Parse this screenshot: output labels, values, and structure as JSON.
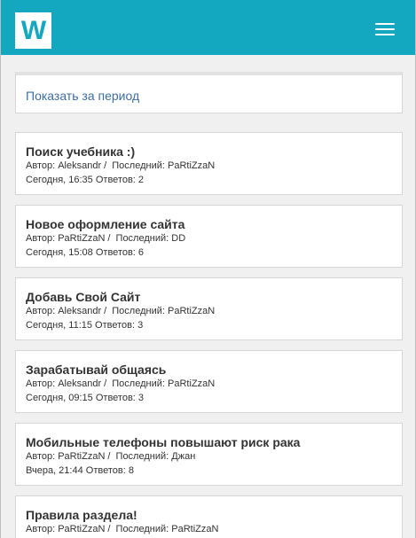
{
  "header": {
    "logo_text": "W",
    "menu_icon": "hamburger-menu-icon",
    "brand_color": "#13a7c0"
  },
  "filter": {
    "link_label": "Показать за период"
  },
  "labels": {
    "author": "Автор:",
    "last": "Последний:",
    "replies": "Ответов:",
    "separator": "/"
  },
  "topics": [
    {
      "title": "Поиск учебника :)",
      "author": "Aleksandr",
      "last": "PaRtiZzaN",
      "date": "Сегодня, 16:35",
      "replies": "2"
    },
    {
      "title": "Новое оформление сайта",
      "author": "PaRtiZzaN",
      "last": "DD",
      "date": "Сегодня, 15:08",
      "replies": "6"
    },
    {
      "title": "Добавь Свой Сайт",
      "author": "Aleksandr",
      "last": "PaRtiZzaN",
      "date": "Сегодня, 11:15",
      "replies": "3"
    },
    {
      "title": "Зарабатывай общаясь",
      "author": "Aleksandr",
      "last": "PaRtiZzaN",
      "date": "Сегодня, 09:15",
      "replies": "3"
    },
    {
      "title": "Мобильные телефоны повышают риск рака",
      "author": "PaRtiZzaN",
      "last": "Джан",
      "date": "Вчера, 21:44",
      "replies": "8"
    },
    {
      "title": "Правила раздела!",
      "author": "PaRtiZzaN",
      "last": "PaRtiZzaN",
      "date": "",
      "replies": ""
    }
  ]
}
